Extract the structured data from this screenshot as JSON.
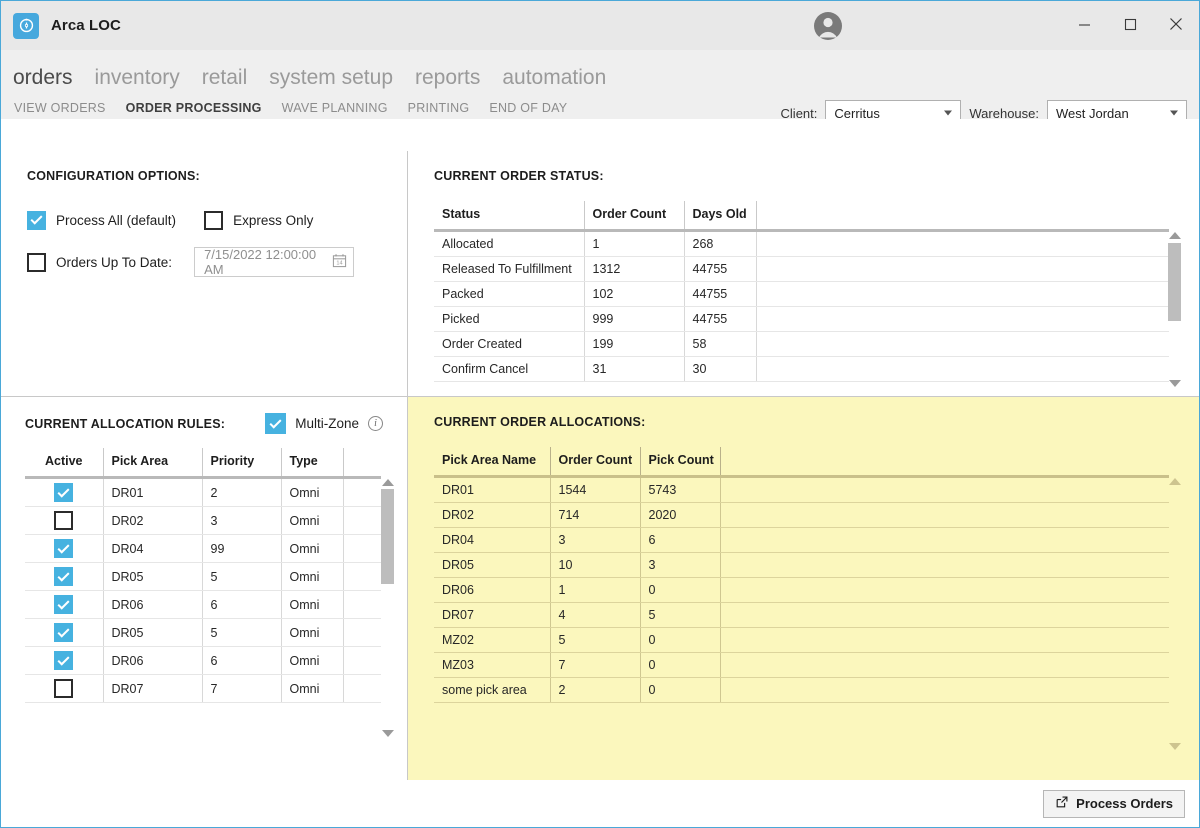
{
  "window": {
    "app_icon": "compass-gauge-icon",
    "title": "Arca LOC",
    "minimize_label": "–",
    "maximize_label": "□",
    "close_label": "✕"
  },
  "nav": {
    "main": [
      {
        "label": "orders",
        "active": true
      },
      {
        "label": "inventory",
        "active": false
      },
      {
        "label": "retail",
        "active": false
      },
      {
        "label": "system setup",
        "active": false
      },
      {
        "label": "reports",
        "active": false
      },
      {
        "label": "automation",
        "active": false
      }
    ],
    "sub": [
      {
        "label": "VIEW ORDERS",
        "active": false
      },
      {
        "label": "ORDER PROCESSING",
        "active": true
      },
      {
        "label": "WAVE PLANNING",
        "active": false
      },
      {
        "label": "PRINTING",
        "active": false
      },
      {
        "label": "END OF DAY",
        "active": false
      }
    ]
  },
  "context": {
    "client_label": "Client:",
    "client_value": "Cerritus",
    "warehouse_label": "Warehouse:",
    "warehouse_value": "West Jordan"
  },
  "configuration": {
    "title": "CONFIGURATION OPTIONS:",
    "process_all_label": "Process All (default)",
    "process_all_checked": true,
    "express_only_label": "Express Only",
    "express_only_checked": false,
    "orders_up_to_date_label": "Orders Up To Date:",
    "orders_up_to_date_checked": false,
    "date_value": "7/15/2022 12:00:00 AM",
    "calendar_icon": "calendar-icon"
  },
  "order_status": {
    "title": "CURRENT ORDER STATUS:",
    "columns": [
      "Status",
      "Order Count",
      "Days Old",
      ""
    ],
    "rows": [
      [
        "Allocated",
        "1",
        "268",
        ""
      ],
      [
        "Released To Fulfillment",
        "1312",
        "44755",
        ""
      ],
      [
        "Packed",
        "102",
        "44755",
        ""
      ],
      [
        "Picked",
        "999",
        "44755",
        ""
      ],
      [
        "Order Created",
        "199",
        "58",
        ""
      ],
      [
        "Confirm Cancel",
        "31",
        "30",
        ""
      ]
    ]
  },
  "allocation_rules": {
    "title": "CURRENT ALLOCATION RULES:",
    "multi_zone_label": "Multi-Zone",
    "multi_zone_checked": true,
    "info_icon": "info-icon",
    "columns": [
      "Active",
      "Pick Area",
      "Priority",
      "Type",
      ""
    ],
    "rows": [
      {
        "active": true,
        "pick_area": "DR01",
        "priority": "2",
        "type": "Omni"
      },
      {
        "active": false,
        "pick_area": "DR02",
        "priority": "3",
        "type": "Omni"
      },
      {
        "active": true,
        "pick_area": "DR04",
        "priority": "99",
        "type": "Omni"
      },
      {
        "active": true,
        "pick_area": "DR05",
        "priority": "5",
        "type": "Omni"
      },
      {
        "active": true,
        "pick_area": "DR06",
        "priority": "6",
        "type": "Omni"
      },
      {
        "active": true,
        "pick_area": "DR05",
        "priority": "5",
        "type": "Omni"
      },
      {
        "active": true,
        "pick_area": "DR06",
        "priority": "6",
        "type": "Omni"
      },
      {
        "active": false,
        "pick_area": "DR07",
        "priority": "7",
        "type": "Omni"
      }
    ]
  },
  "order_allocations": {
    "title": "CURRENT ORDER ALLOCATIONS:",
    "columns": [
      "Pick Area Name",
      "Order Count",
      "Pick Count",
      ""
    ],
    "rows": [
      [
        "DR01",
        "1544",
        "5743",
        ""
      ],
      [
        "DR02",
        "714",
        "2020",
        ""
      ],
      [
        "DR04",
        "3",
        "6",
        ""
      ],
      [
        "DR05",
        "10",
        "3",
        ""
      ],
      [
        "DR06",
        "1",
        "0",
        ""
      ],
      [
        "DR07",
        "4",
        "5",
        ""
      ],
      [
        "MZ02",
        "5",
        "0",
        ""
      ],
      [
        "MZ03",
        "7",
        "0",
        ""
      ],
      [
        "some pick area",
        "2",
        "0",
        ""
      ]
    ]
  },
  "footer": {
    "process_orders_label": "Process Orders",
    "process_orders_icon": "external-link-icon"
  },
  "colors": {
    "accent": "#46b2e0",
    "window_border": "#4aa8d8",
    "highlight_panel": "#fbf7bd",
    "titlebar": "#e8e8e8",
    "navbar": "#efefef"
  }
}
